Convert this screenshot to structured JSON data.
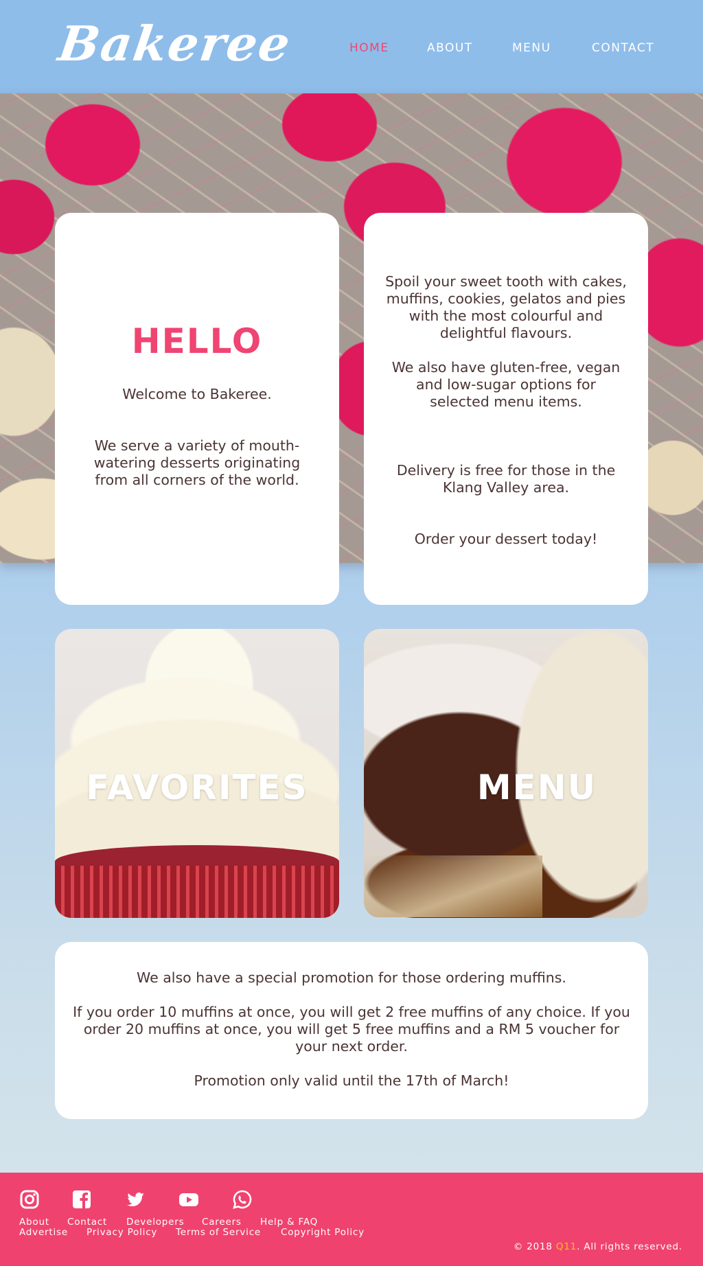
{
  "header": {
    "logo": "Bakeree",
    "nav": [
      {
        "label": "HOME",
        "active": true
      },
      {
        "label": "ABOUT",
        "active": false
      },
      {
        "label": "MENU",
        "active": false
      },
      {
        "label": "CONTACT",
        "active": false
      }
    ]
  },
  "intro": {
    "title": "HELLO",
    "welcome": "Welcome to Bakeree.",
    "description": "We serve a variety of mouth-watering desserts originating from all corners of the world."
  },
  "info": {
    "p1": "Spoil your sweet tooth with cakes, muffins, cookies, gelatos and pies with the most colourful and delightful flavours.",
    "p2": "We also have gluten-free, vegan and low-sugar options for selected menu items.",
    "p3": "Delivery is free for those in the Klang Valley area.",
    "p4": "Order your dessert today!"
  },
  "tiles": {
    "favorites": "FAVORITES",
    "menu": "MENU"
  },
  "promo": {
    "p1": "We also have a special promotion for those ordering muffins.",
    "p2": "If you order 10 muffins at once, you will get 2 free muffins of any choice. If you order 20 muffins at once, you will get 5 free muffins and a RM 5 voucher for your next order.",
    "p3": "Promotion only valid until the 17th of March!"
  },
  "footer": {
    "social": [
      "instagram-icon",
      "facebook-icon",
      "twitter-icon",
      "youtube-icon",
      "whatsapp-icon"
    ],
    "links_row1": [
      "About",
      "Contact",
      "Developers",
      "Careers",
      "Help & FAQ"
    ],
    "links_row2": [
      "Advertise",
      "Privacy Policy",
      "Terms of Service",
      "Copyright Policy"
    ],
    "copyright_prefix": "© 2018 ",
    "copyright_brand": "Q11",
    "copyright_suffix": ". All rights reserved."
  },
  "colors": {
    "header_bg": "#8fbdea",
    "accent_pink": "#f04472",
    "footer_bg": "#f0426f",
    "brand_yellow": "#f7c21a"
  }
}
